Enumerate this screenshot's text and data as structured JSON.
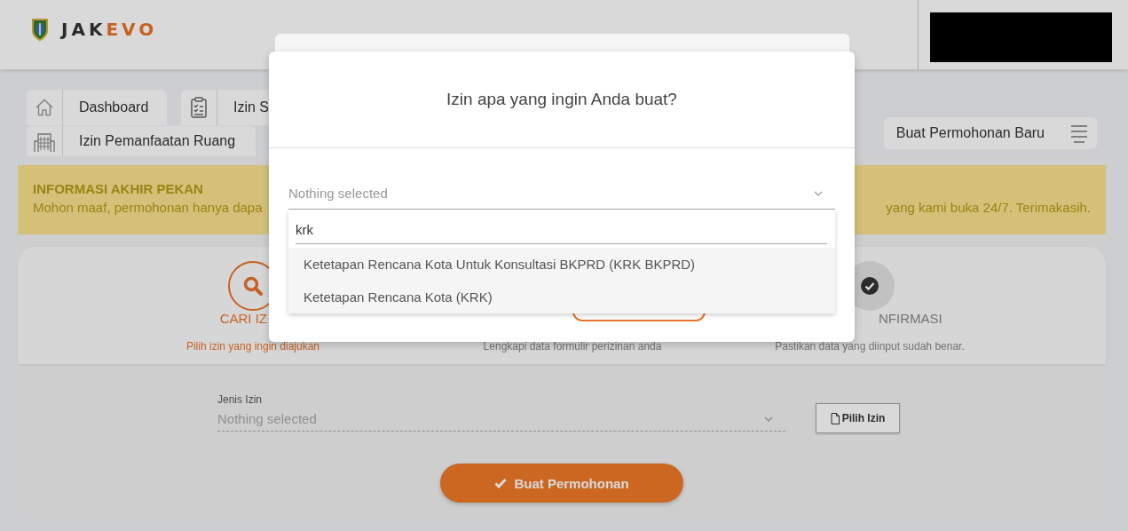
{
  "header": {
    "logo": {
      "dark": "JAK",
      "accent": "EVO"
    }
  },
  "nav": {
    "tabs": [
      {
        "label": "Dashboard"
      },
      {
        "label": "Izin S"
      },
      {
        "label": "Izin Pemanfaatan Ruang"
      }
    ],
    "new_request_button": "Buat Permohonan Baru"
  },
  "banner": {
    "title": "INFORMASI AKHIR PEKAN",
    "message_parts": [
      "Mohon maaf, permohonan hanya dapa",
      "yang kami buka 24/7. Terimakasih."
    ]
  },
  "steps": [
    {
      "label": "CARI IZ",
      "description": "Pilih izin yang ingin diajukan",
      "active": true
    },
    {
      "description": "Lengkapi data formulir perizinan anda",
      "active": false
    },
    {
      "label": "NFIRMASI",
      "description": "Pastikan data yang diinput sudah benar.",
      "active": false
    }
  ],
  "form": {
    "label": "Jenis Izin",
    "placeholder": "Nothing selected",
    "pick_button": "Pilih Izin",
    "submit_button": "Buat Permohonan"
  },
  "modal": {
    "title": "Izin apa yang ingin Anda buat?",
    "select_placeholder": "Nothing selected",
    "search_value": "krk",
    "options": [
      {
        "label": "Ketetapan Rencana Kota Untuk Konsultasi BKPRD (KRK BKPRD)",
        "selected": false
      },
      {
        "label": "Ketetapan Rencana Kota (KRK)",
        "selected": false
      }
    ]
  }
}
